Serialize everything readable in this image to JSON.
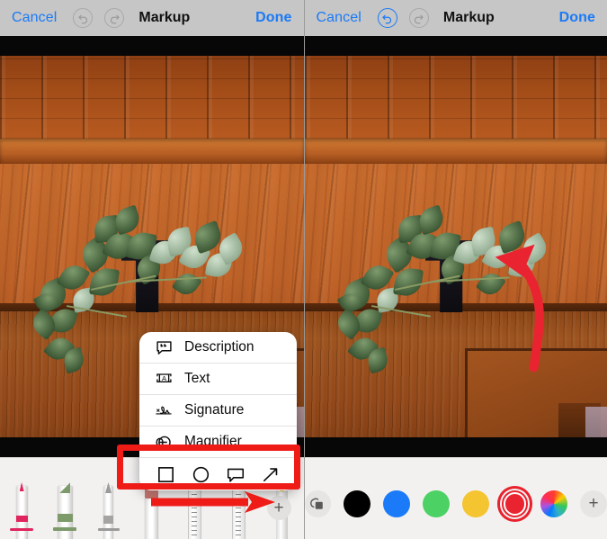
{
  "app": {
    "title": "Markup"
  },
  "panels": [
    {
      "id": "left",
      "header": {
        "cancel_label": "Cancel",
        "title": "Markup",
        "done_label": "Done",
        "undo_icon": "undo-icon",
        "redo_icon": "redo-icon",
        "undo_enabled": "false",
        "redo_enabled": "false"
      },
      "popup_menu": {
        "items": [
          {
            "label": "Description",
            "icon": "description-bubble-icon"
          },
          {
            "label": "Text",
            "icon": "text-box-icon"
          },
          {
            "label": "Signature",
            "icon": "signature-icon"
          },
          {
            "label": "Magnifier",
            "icon": "magnifier-icon"
          }
        ],
        "shapes": [
          {
            "name": "square-shape-icon"
          },
          {
            "name": "circle-shape-icon"
          },
          {
            "name": "speech-bubble-shape-icon"
          },
          {
            "name": "arrow-shape-icon"
          }
        ]
      },
      "toolbar": {
        "tools": [
          {
            "name": "pen-tool",
            "color": "#e0245e"
          },
          {
            "name": "highlighter-tool",
            "color": "#7d9a6a"
          },
          {
            "name": "pencil-tool",
            "color": "#9a9a9a"
          },
          {
            "name": "eraser-tool",
            "color": "#c2706a"
          },
          {
            "name": "ruler-tool",
            "color": "#dddddd"
          },
          {
            "name": "lasso-tool",
            "color": "#e0a80f"
          }
        ],
        "add_label": "+"
      },
      "annotations": {
        "red_box_around": "shape-tools-row",
        "red_arrow_points_to": "add-tool-button",
        "highlight_color": "#ee1b17"
      }
    },
    {
      "id": "right",
      "header": {
        "cancel_label": "Cancel",
        "title": "Markup",
        "done_label": "Done",
        "undo_icon": "undo-icon",
        "redo_icon": "redo-icon",
        "undo_enabled": "true",
        "redo_enabled": "false"
      },
      "toolbar": {
        "opacity_icon": "layers-opacity-icon",
        "colors": [
          {
            "name": "black",
            "hex": "#000000",
            "selected": "false"
          },
          {
            "name": "blue",
            "hex": "#1a7af8",
            "selected": "false"
          },
          {
            "name": "green",
            "hex": "#4cd164",
            "selected": "false"
          },
          {
            "name": "yellow",
            "hex": "#f5c431",
            "selected": "false"
          },
          {
            "name": "red",
            "hex": "#ea2330",
            "selected": "true"
          },
          {
            "name": "rainbow",
            "hex": "rainbow",
            "selected": "false"
          }
        ],
        "add_label": "+"
      },
      "canvas_annotation": {
        "type": "curved-arrow",
        "color": "#ea2330",
        "handles": [
          {
            "name": "arrow-head-handle",
            "color": "#1a6ff0"
          },
          {
            "name": "curve-control-handle",
            "color": "#2fbf23"
          },
          {
            "name": "arrow-tail-handle",
            "color": "#1a6ff0"
          }
        ]
      }
    }
  ],
  "photo": {
    "subject": "ivy plant in dark wall sconce on orange wooden paneling"
  }
}
